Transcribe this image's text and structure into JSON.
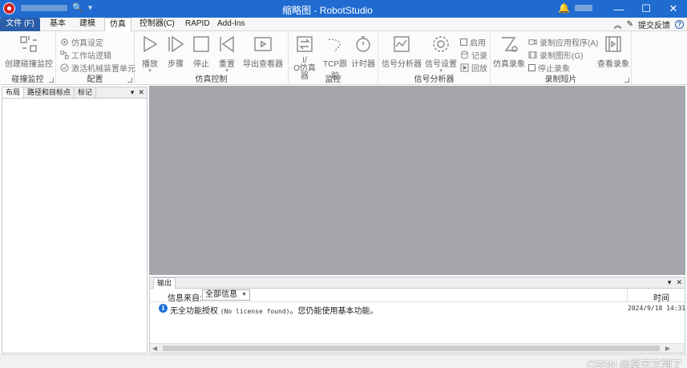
{
  "window": {
    "title": "缩略图 - RobotStudio",
    "minimize": "—",
    "maximize": "☐",
    "close": "✕"
  },
  "qat": {
    "undo": "↶",
    "search": "🔍",
    "more": "▾"
  },
  "tabs": {
    "file": "文件 (F)",
    "items": [
      "基本",
      "建模",
      "仿真",
      "控制器(C)",
      "RAPID",
      "Add-Ins"
    ],
    "active": "仿真"
  },
  "top_right": {
    "collapse": "︽",
    "feedback": "提交反馈",
    "help": "?"
  },
  "ribbon": {
    "collision": {
      "title": "碰撞监控",
      "create": "创建碰撞监控"
    },
    "config": {
      "title": "配置",
      "sim_setting": "仿真设定",
      "station_logic": "工作站逻辑",
      "activate_mech": "激活机械装置单元"
    },
    "sim_control": {
      "title": "仿真控制",
      "play": "播放",
      "step": "步骤",
      "stop": "停止",
      "reset": "重置",
      "export_viewer": "导出查看器"
    },
    "monitor": {
      "title": "监控",
      "io_sim_line1": "I/",
      "io_sim_line2": "O仿真器",
      "tcp_trace": "TCP跟踪",
      "timer": "计时器"
    },
    "signal": {
      "title": "信号分析器",
      "analyzer": "信号分析器",
      "settings": "信号设置",
      "enable": "启用",
      "record": "记录",
      "playback": "回放"
    },
    "recording": {
      "title": "录制短片",
      "sim_record": "仿真录象",
      "record_app": "录制应用程序(A)",
      "record_graphics": "录制图形(G)",
      "stop_record": "停止录象",
      "view_record": "查看录象"
    }
  },
  "left_panel": {
    "tabs": [
      "布局",
      "路径和目标点",
      "标记"
    ],
    "pin": "▾",
    "close": "✕"
  },
  "output": {
    "tab": "输出",
    "source_label": "信息来自:",
    "source_value": "全部信息",
    "time_header": "时间",
    "rows": [
      {
        "message_prefix": "无全功能授权",
        "message_mono": "(No license found)",
        "message_suffix": "。您仍能使用基本功能。",
        "time": "2024/9/18 14:31:"
      }
    ]
  },
  "watermark": "CSDN @夏天又到了",
  "colors": {
    "titlebar": "#1f6bd0",
    "file_tab": "#2a5ea8",
    "canvas": "#a4a6ab",
    "info": "#1e6fd9"
  }
}
